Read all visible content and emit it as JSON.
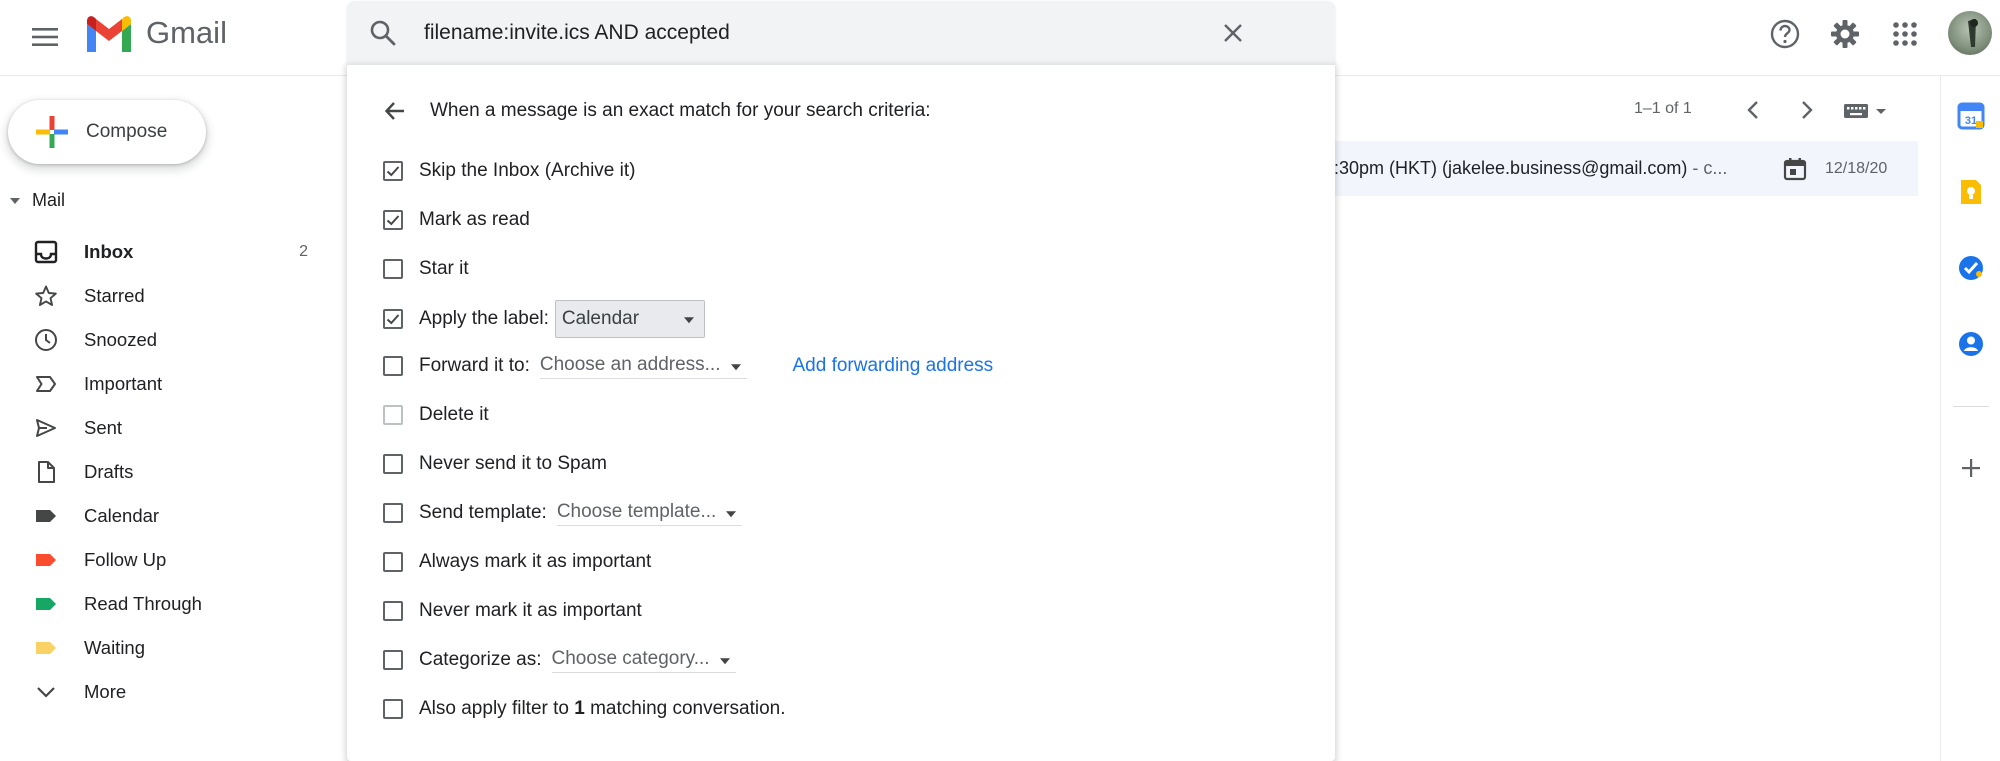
{
  "app": {
    "name": "Gmail"
  },
  "search": {
    "query": "filename:invite.ics AND accepted"
  },
  "compose": {
    "label": "Compose"
  },
  "mail_section": {
    "label": "Mail"
  },
  "nav": {
    "items": [
      {
        "label": "Inbox",
        "count": "2",
        "icon": "inbox-icon"
      },
      {
        "label": "Starred",
        "icon": "star-icon"
      },
      {
        "label": "Snoozed",
        "icon": "clock-icon"
      },
      {
        "label": "Important",
        "icon": "important-icon"
      },
      {
        "label": "Sent",
        "icon": "send-icon"
      },
      {
        "label": "Drafts",
        "icon": "draft-icon"
      },
      {
        "label": "Calendar",
        "icon": "label-icon",
        "color": "#444746"
      },
      {
        "label": "Follow Up",
        "icon": "label-icon",
        "color": "#fb4c2f"
      },
      {
        "label": "Read Through",
        "icon": "label-icon",
        "color": "#16a765"
      },
      {
        "label": "Waiting",
        "icon": "label-icon",
        "color": "#fad165"
      },
      {
        "label": "More",
        "icon": "chevron-down-icon"
      }
    ]
  },
  "list": {
    "pagination": "1–1 of 1",
    "message": {
      "snippet": ":30pm (HKT) (jakelee.business@gmail.com)",
      "snippet_tail": " - c...",
      "date": "12/18/20"
    }
  },
  "filter": {
    "heading": "When a message is an exact match for your search criteria:",
    "options": {
      "skip_inbox": {
        "label": "Skip the Inbox (Archive it)",
        "checked": true
      },
      "mark_read": {
        "label": "Mark as read",
        "checked": true
      },
      "star": {
        "label": "Star it",
        "checked": false
      },
      "apply_label": {
        "label": "Apply the label:",
        "checked": true,
        "value": "Calendar"
      },
      "forward": {
        "label": "Forward it to:",
        "checked": false,
        "value": "Choose an address...",
        "link": "Add forwarding address"
      },
      "delete": {
        "label": "Delete it",
        "checked": false
      },
      "never_spam": {
        "label": "Never send it to Spam",
        "checked": false
      },
      "send_template": {
        "label": "Send template:",
        "checked": false,
        "value": "Choose template..."
      },
      "always_important": {
        "label": "Always mark it as important",
        "checked": false
      },
      "never_important": {
        "label": "Never mark it as important",
        "checked": false
      },
      "categorize": {
        "label": "Categorize as:",
        "checked": false,
        "value": "Choose category..."
      },
      "also_apply": {
        "prefix": "Also apply filter to ",
        "count": "1",
        "suffix": " matching conversation.",
        "checked": false
      }
    }
  },
  "colors": {
    "accent_blue": "#1a73e8",
    "compose_plus": [
      "#ea4335",
      "#fbbc04",
      "#34a853",
      "#4285f4"
    ]
  }
}
